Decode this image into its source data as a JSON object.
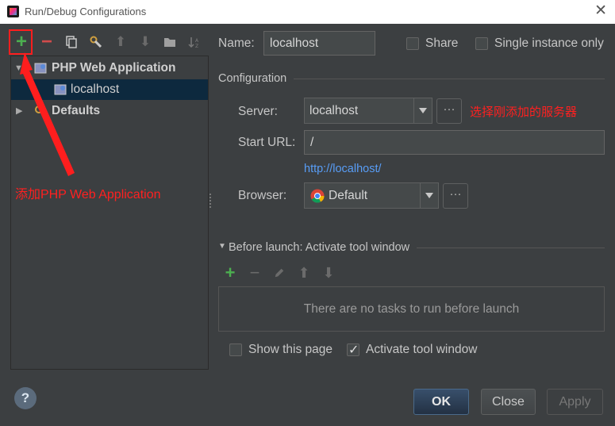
{
  "window": {
    "title": "Run/Debug Configurations",
    "close_glyph": "✕"
  },
  "left_toolbar": {
    "add_glyph": "+",
    "remove_glyph": "−",
    "up_glyph": "⬆",
    "down_glyph": "⬇"
  },
  "tree": {
    "items": [
      {
        "label": "PHP Web Application",
        "expanded": true,
        "icon": "php-web-app-icon"
      },
      {
        "label": "localhost",
        "selected": true,
        "icon": "php-web-app-icon"
      },
      {
        "label": "Defaults",
        "expanded": false,
        "icon": "wrench-gear-icon"
      }
    ],
    "expanded_glyph": "▼",
    "collapsed_glyph": "▶"
  },
  "form": {
    "name_label": "Name:",
    "name_value": "localhost",
    "share_label": "Share",
    "share_checked": false,
    "single_instance_label": "Single instance only",
    "single_instance_checked": false,
    "configuration_title": "Configuration",
    "server_label": "Server:",
    "server_value": "localhost",
    "start_url_label": "Start URL:",
    "start_url_value": "/",
    "url_preview": "http://localhost/",
    "browser_label": "Browser:",
    "browser_value": "Default",
    "dots": "···"
  },
  "before_launch": {
    "title": "Before launch: Activate tool window",
    "empty_text": "There are no tasks to run before launch",
    "show_page_label": "Show this page",
    "show_page_checked": false,
    "activate_label": "Activate tool window",
    "activate_checked": true,
    "add_glyph": "+",
    "remove_glyph": "−",
    "up_glyph": "⬆",
    "down_glyph": "⬇"
  },
  "annotations": {
    "server_hint": "选择刚添加的服务器",
    "add_hint": "添加PHP Web Application"
  },
  "buttons": {
    "ok": "OK",
    "close": "Close",
    "apply": "Apply",
    "help": "?"
  },
  "colors": {
    "accent_red": "#ff2020",
    "link": "#589df6",
    "add_green": "#4caf50",
    "background": "#3c3f41"
  }
}
